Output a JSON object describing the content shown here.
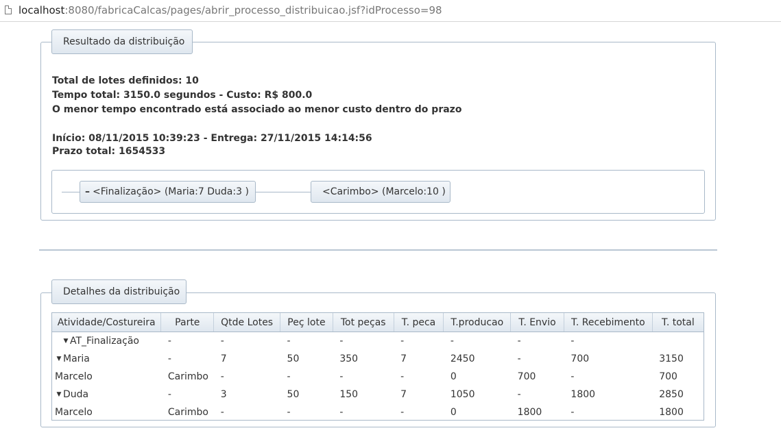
{
  "browser": {
    "url_host": "localhost",
    "url_rest": ":8080/fabricaCalcas/pages/abrir_processo_distribuicao.jsf?idProcesso=98"
  },
  "result_panel": {
    "legend": "Resultado da distribuição",
    "lines": [
      "Total de lotes definidos: 10",
      "Tempo total: 3150.0 segundos - Custo: R$ 800.0",
      "O menor tempo encontrado está associado ao menor custo dentro do prazo",
      "Início: 08/11/2015 10:39:23 - Entrega: 27/11/2015 14:14:56",
      "Prazo total: 1654533"
    ],
    "flow_nodes": [
      {
        "toggle": "–",
        "label": "<Finalização> (Maria:7 Duda:3 )"
      },
      {
        "label": "<Carimbo> (Marcelo:10 )"
      }
    ]
  },
  "details_panel": {
    "legend": "Detalhes da distribuição",
    "columns": [
      "Atividade/Costureira",
      "Parte",
      "Qtde Lotes",
      "Peç lote",
      "Tot peças",
      "T. peca",
      "T.producao",
      "T. Envio",
      "T. Recebimento",
      "T. total"
    ],
    "rows": [
      {
        "name": "AT_Finalização",
        "expanded": true,
        "cells": [
          "-",
          "-",
          "-",
          "-",
          "-",
          "-",
          "-",
          "-",
          ""
        ]
      },
      {
        "name": "Maria",
        "expanded": true,
        "cells": [
          "-",
          "7",
          "50",
          "350",
          "7",
          "2450",
          "-",
          "700",
          "3150"
        ]
      },
      {
        "name": "Marcelo",
        "cells": [
          "Carimbo",
          "-",
          "-",
          "-",
          "-",
          "0",
          "700",
          "-",
          "700"
        ]
      },
      {
        "name": "Duda",
        "expanded": true,
        "cells": [
          "-",
          "3",
          "50",
          "150",
          "7",
          "1050",
          "-",
          "1800",
          "2850"
        ]
      },
      {
        "name": "Marcelo",
        "cells": [
          "Carimbo",
          "-",
          "-",
          "-",
          "-",
          "0",
          "1800",
          "-",
          "1800"
        ]
      }
    ]
  }
}
